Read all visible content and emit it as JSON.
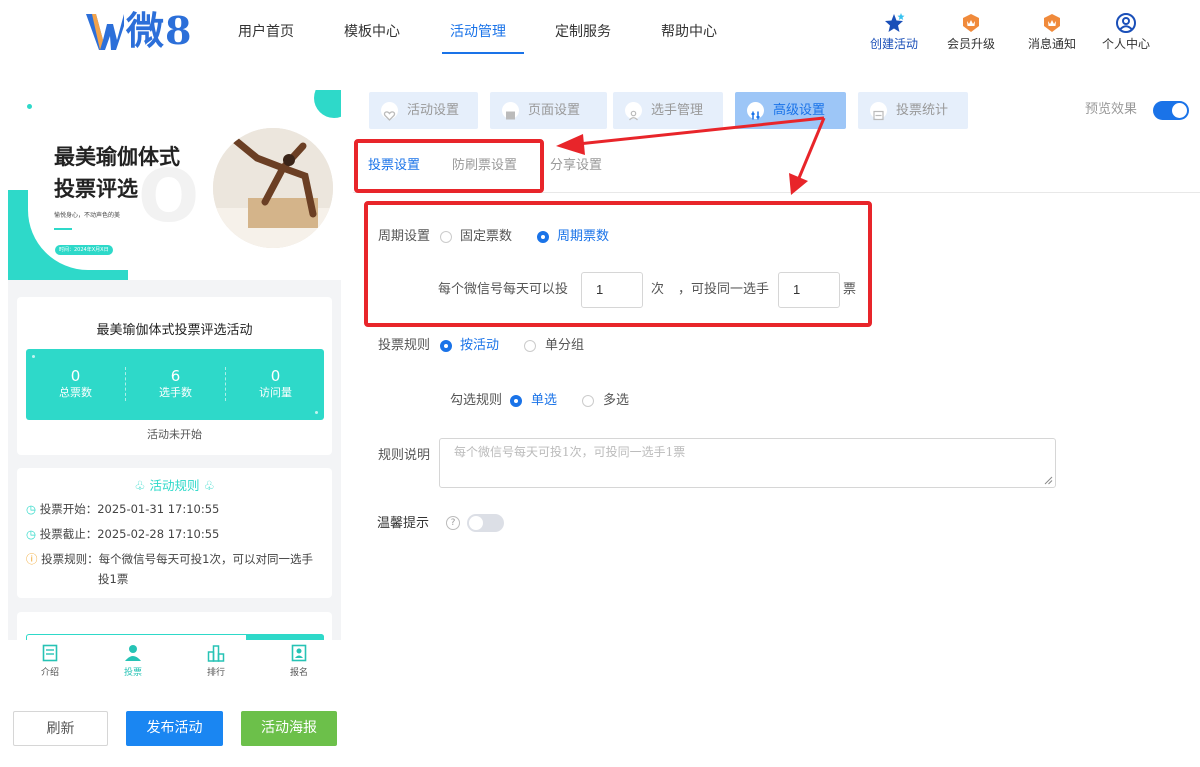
{
  "header": {
    "logo_text": "微8",
    "nav": [
      "用户首页",
      "模板中心",
      "活动管理",
      "定制服务",
      "帮助中心"
    ],
    "actions": [
      {
        "label": "创建活动",
        "icon": "star-icon",
        "color": "#1a4fb8"
      },
      {
        "label": "会员升级",
        "icon": "crown-icon",
        "color": "#f08a3b"
      },
      {
        "label": "消息通知",
        "icon": "bell-icon",
        "color": "#f08a3b"
      },
      {
        "label": "个人中心",
        "icon": "user-circle-icon",
        "color": "#1a4fb8"
      }
    ]
  },
  "preview": {
    "banner_title_1": "最美瑜伽体式",
    "banner_title_2": "投票评选",
    "banner_sub": "愉悦身心，不动声色的美",
    "banner_date": "时间：2024年X月X日",
    "event_title": "最美瑜伽体式投票评选活动",
    "stats": [
      {
        "num": "0",
        "label": "总票数"
      },
      {
        "num": "6",
        "label": "选手数"
      },
      {
        "num": "0",
        "label": "访问量"
      }
    ],
    "status": "活动未开始",
    "rules_title": "活动规则",
    "rules": [
      {
        "key": "投票开始：",
        "val": "2025-01-31 17:10:55"
      },
      {
        "key": "投票截止：",
        "val": "2025-02-28 17:10:55"
      },
      {
        "key": "投票规则：",
        "val": "每个微信号每天可投1次，可以对同一选手",
        "val2": "投1票"
      }
    ],
    "tabs": [
      {
        "label": "介绍",
        "icon": "doc-icon"
      },
      {
        "label": "投票",
        "icon": "user-icon"
      },
      {
        "label": "排行",
        "icon": "rank-icon"
      },
      {
        "label": "报名",
        "icon": "signup-icon"
      }
    ]
  },
  "bottom_buttons": {
    "refresh": "刷新",
    "publish": "发布活动",
    "poster": "活动海报"
  },
  "steps": [
    {
      "label": "活动设置",
      "icon": "heart-icon"
    },
    {
      "label": "页面设置",
      "icon": "image-icon"
    },
    {
      "label": "选手管理",
      "icon": "person-icon"
    },
    {
      "label": "高级设置",
      "icon": "settings-icon"
    },
    {
      "label": "投票统计",
      "icon": "stats-icon"
    }
  ],
  "preview_toggle_label": "预览效果",
  "preview_toggle_on": true,
  "subtabs": [
    "投票设置",
    "防刷票设置",
    "分享设置"
  ],
  "form": {
    "cycle_label": "周期设置",
    "cycle_options": [
      "固定票数",
      "周期票数"
    ],
    "cycle_selected": "周期票数",
    "per_day_prefix": "每个微信号每天可以投",
    "per_day_value": "1",
    "per_day_unit": "次",
    "same_prefix": "，可投同一选手",
    "same_value": "1",
    "same_unit": "票",
    "vote_rule_label": "投票规则",
    "vote_rule_options": [
      "按活动",
      "单分组"
    ],
    "vote_rule_selected": "按活动",
    "check_rule_label": "勾选规则",
    "check_rule_options": [
      "单选",
      "多选"
    ],
    "check_rule_selected": "单选",
    "desc_label": "规则说明",
    "desc_placeholder": "每个微信号每天可投1次，可投同一选手1票",
    "tip_label": "温馨提示",
    "tip_on": false
  },
  "colors": {
    "accent": "#1a73e8",
    "teal": "#2ed9c9",
    "annotation_red": "#e8252a",
    "green": "#6cc04a"
  }
}
